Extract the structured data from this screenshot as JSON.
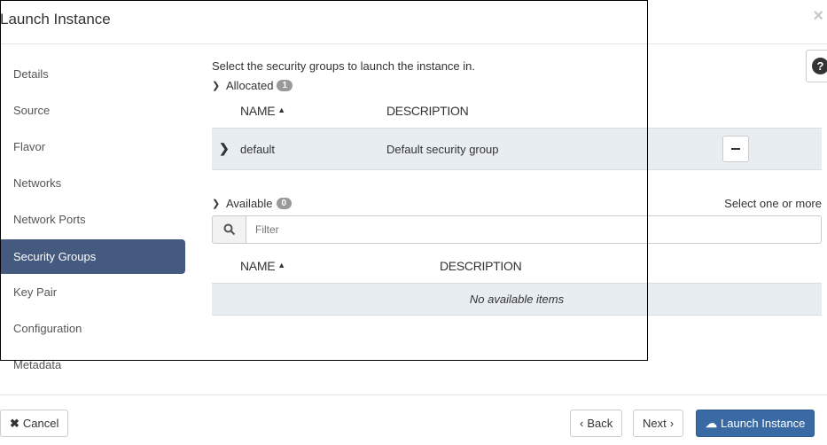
{
  "window": {
    "title": "Launch Instance",
    "close_glyph": "×"
  },
  "sidebar": {
    "items": [
      {
        "label": "Details"
      },
      {
        "label": "Source"
      },
      {
        "label": "Flavor"
      },
      {
        "label": "Networks"
      },
      {
        "label": "Network Ports"
      },
      {
        "label": "Security Groups",
        "active": true
      },
      {
        "label": "Key Pair"
      },
      {
        "label": "Configuration"
      },
      {
        "label": "Metadata"
      }
    ]
  },
  "main": {
    "intro": "Select the security groups to launch the instance in.",
    "allocated": {
      "label": "Allocated",
      "count": "1",
      "columns": {
        "name": "NAME",
        "description": "DESCRIPTION"
      },
      "rows": [
        {
          "name": "default",
          "description": "Default security group"
        }
      ]
    },
    "available": {
      "label": "Available",
      "count": "0",
      "hint": "Select one or more",
      "filter_placeholder": "Filter",
      "columns": {
        "name": "NAME",
        "description": "DESCRIPTION"
      },
      "empty_text": "No available items"
    }
  },
  "footer": {
    "cancel_label": "Cancel",
    "back_label": "Back",
    "next_label": "Next",
    "launch_label": "Launch Instance"
  },
  "colors": {
    "active_nav": "#455a7f",
    "primary_button": "#3a6aa3",
    "row_background": "#e8edf2"
  },
  "icons": [
    "close-icon",
    "chevron-down-icon",
    "chevron-right-icon",
    "sort-asc-icon",
    "search-icon",
    "minus-icon",
    "help-icon",
    "times-icon",
    "cloud-upload-icon"
  ]
}
